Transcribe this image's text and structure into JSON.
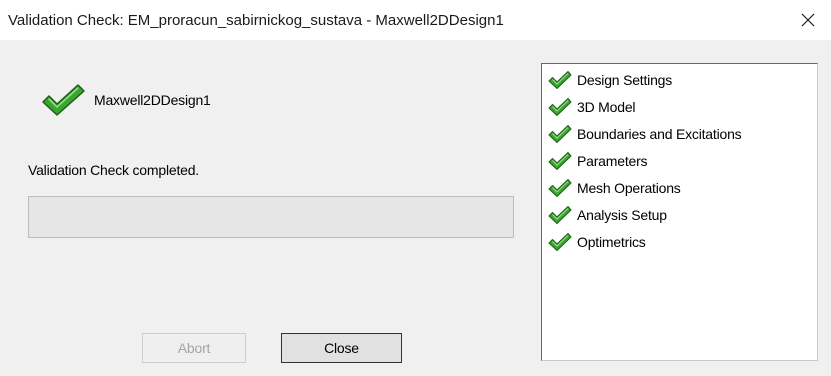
{
  "window": {
    "title": "Validation Check: EM_proracun_sabirnickog_sustava - Maxwell2DDesign1"
  },
  "design": {
    "name": "Maxwell2DDesign1",
    "icon": "check-icon"
  },
  "status": {
    "message": "Validation Check completed.",
    "progress": 0
  },
  "buttons": {
    "abort_label": "Abort",
    "abort_enabled": false,
    "close_label": "Close"
  },
  "checks": [
    {
      "label": "Design Settings",
      "icon": "check-icon"
    },
    {
      "label": "3D Model",
      "icon": "check-icon"
    },
    {
      "label": "Boundaries and Excitations",
      "icon": "check-icon"
    },
    {
      "label": "Parameters",
      "icon": "check-icon"
    },
    {
      "label": "Mesh Operations",
      "icon": "check-icon"
    },
    {
      "label": "Analysis Setup",
      "icon": "check-icon"
    },
    {
      "label": "Optimetrics",
      "icon": "check-icon"
    }
  ],
  "colors": {
    "check_green": "#3aa530",
    "check_outline": "#1e5e14"
  }
}
